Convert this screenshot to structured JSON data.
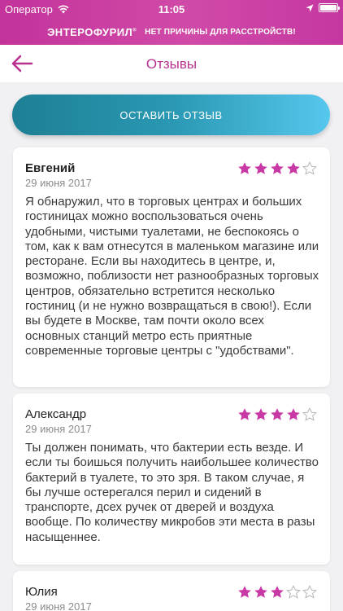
{
  "status_bar": {
    "carrier": "Оператор",
    "time": "11:05"
  },
  "brand": {
    "name": "ЭНТЕРОФУРИЛ",
    "mark": "®",
    "slogan": "НЕТ ПРИЧИНЫ ДЛЯ РАССТРОЙСТВ!"
  },
  "nav": {
    "title": "Отзывы"
  },
  "cta": {
    "label": "ОСТАВИТЬ ОТЗЫВ"
  },
  "colors": {
    "brand_pink": "#c3339a",
    "title_pink": "#b8318f",
    "star_filled": "#c939a6",
    "cta_start": "#1e7f94",
    "cta_end": "#56c7ed"
  },
  "reviews": [
    {
      "author": "Евгений",
      "date": "29 июня 2017",
      "rating": 4,
      "max_rating": 5,
      "text": "Я обнаружил, что в торговых центрах и больших гостиницах можно воспользоваться очень удобными, чистыми туалетами, не беспокоясь о том, как к вам отнесутся в маленьком магазине или ресторане. Если вы находитесь в центре, и, возможно, поблизости нет разнообразных торговых центров, обязательно встретится несколько гостиниц (и не нужно возвращаться в свою!). Если вы будете в Москве, там почти около всех основных станций метро есть приятные современные торговые центры с \"удобствами\"."
    },
    {
      "author": "Александр",
      "date": "29 июня 2017",
      "rating": 4,
      "max_rating": 5,
      "text": "Ты должен понимать, что бактерии есть везде. И если ты боишься получить наибольшее количество бактерий в туалете, то это зря. В таком случае, я бы лучше остерегался перил и сидений в транспорте, дсех ручек от дверей и воздуха вообще. По количеству микробов эти места в разы насыщеннее."
    },
    {
      "author": "Юлия",
      "date": "29 июня 2017",
      "rating": 3,
      "max_rating": 5,
      "text": ""
    }
  ]
}
